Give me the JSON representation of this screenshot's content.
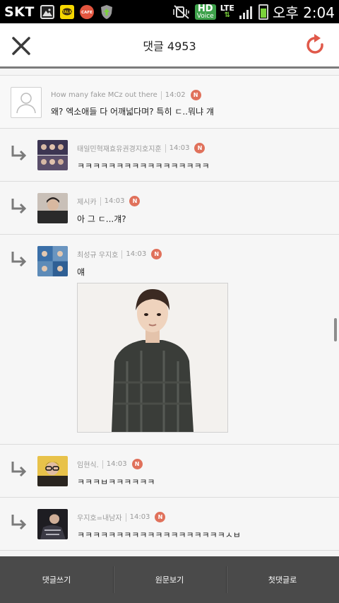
{
  "status_bar": {
    "carrier": "SKT",
    "notification_icons": [
      "gallery-icon",
      "kakaotalk-icon",
      "cafe-icon",
      "shield-icon"
    ],
    "hd_label": "HD",
    "voice_label": "Voice",
    "network_label": "LTE",
    "time": "오후 2:04"
  },
  "header": {
    "title": "댓글 4953",
    "close_icon": "close-icon",
    "refresh_icon": "refresh-icon",
    "accent_color": "#e0594a"
  },
  "comments": [
    {
      "type": "main",
      "author": "How many fake MCz out there",
      "time": "14:02",
      "badge": "N",
      "text": "왜? 엑소애들 다 어깨넓다며? 특히 ㄷ..뭐냐 걔"
    },
    {
      "type": "reply",
      "author": "태일민혁재효유권경지호지훈",
      "time": "14:03",
      "badge": "N",
      "text": "ㅋㅋㅋㅋㅋㅋㅋㅋㅋㅋㅋㅋㅋㅋㅋㅋㅋ"
    },
    {
      "type": "reply",
      "author": "제시카",
      "time": "14:03",
      "badge": "N",
      "text": "아 그 ㄷ...걔?"
    },
    {
      "type": "reply",
      "author": "최성규 우지호",
      "time": "14:03",
      "badge": "N",
      "text": "얘"
    },
    {
      "type": "reply",
      "author": "임현식.",
      "time": "14:03",
      "badge": "N",
      "text": "ㅋㅋㅋㅂㅋㅋㅋㅋㅋㅋ"
    },
    {
      "type": "reply",
      "author": "우지호=내남자",
      "time": "14:03",
      "badge": "N",
      "text": "ㅋㅋㅋㅋㅋㅋㅋㅋㅋㅋㅋㅋㅋㅋㅋㅋㅋㅋㅋㅅㅂ"
    }
  ],
  "bottom_bar": {
    "write_label": "댓글쓰기",
    "original_label": "원문보기",
    "first_label": "첫댓글로"
  }
}
